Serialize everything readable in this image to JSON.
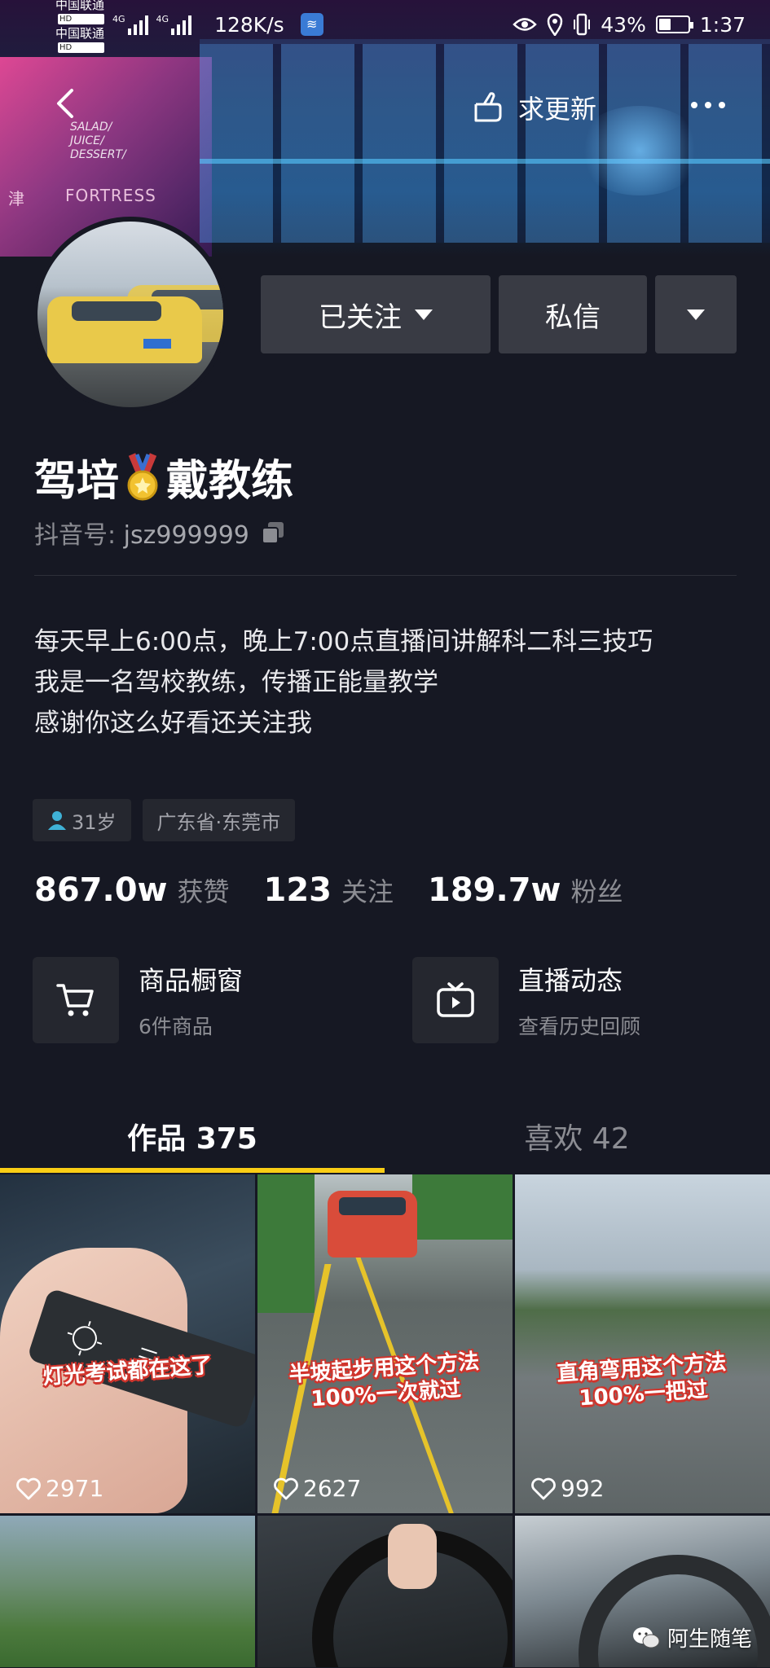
{
  "status_bar": {
    "carrier1": "中国联通",
    "carrier2": "中国联通",
    "hd_badge": "HD",
    "network": "4G",
    "speed": "128K/s",
    "battery_percent": 43,
    "battery_text": "43%",
    "time": "1:37"
  },
  "cover": {
    "sign_salad": "SALAD/\nJUICE/\nDESSERT/",
    "sign_fortress": "FORTRESS",
    "sign_cn": "津"
  },
  "nav": {
    "update_label": "求更新"
  },
  "actions": {
    "follow_label": "已关注",
    "message_label": "私信"
  },
  "profile": {
    "name_part1": "驾培",
    "name_part2": "戴教练",
    "handle_label": "抖音号:",
    "handle_value": "jsz999999",
    "bio": [
      "每天早上6:00点，晚上7:00点直播间讲解科二科三技巧",
      "我是一名驾校教练，传播正能量教学",
      "感谢你这么好看还关注我"
    ],
    "age_tag": "31岁",
    "location_tag": "广东省·东莞市"
  },
  "stats": {
    "likes_value": "867.0w",
    "likes_label": "获赞",
    "following_value": "123",
    "following_label": "关注",
    "fans_value": "189.7w",
    "fans_label": "粉丝"
  },
  "cards": {
    "shop_title": "商品橱窗",
    "shop_sub": "6件商品",
    "live_title": "直播动态",
    "live_sub": "查看历史回顾"
  },
  "tabs": {
    "works": "作品 375",
    "likes": "喜欢 42"
  },
  "videos": [
    {
      "caption": "灯光考试都在这了",
      "likes": "2971"
    },
    {
      "caption": "半坡起步用这个方法\n100%一次就过",
      "likes": "2627"
    },
    {
      "caption": "直角弯用这个方法\n100%一把过",
      "likes": "992"
    }
  ],
  "watermark": "阿生随笔",
  "colors": {
    "background": "#161823",
    "button": "#393b44",
    "tab_indicator": "#face15",
    "caption_outline": "#d0342c"
  }
}
